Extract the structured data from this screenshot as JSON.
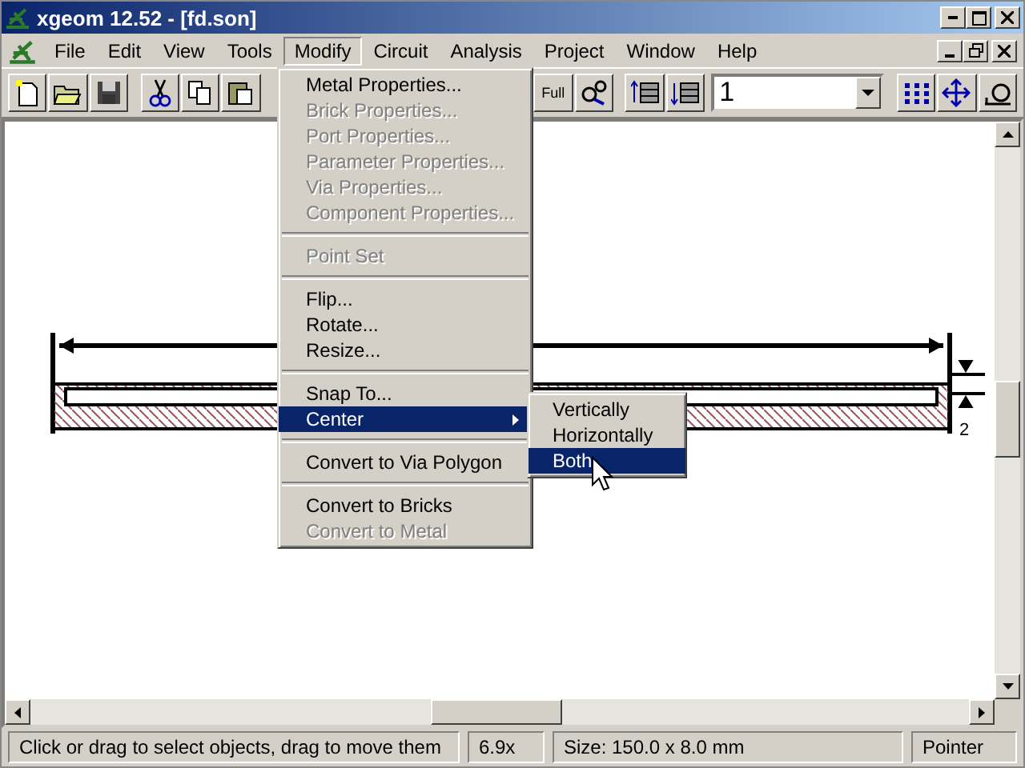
{
  "window": {
    "title": "xgeom 12.52 - [fd.son]"
  },
  "menubar": [
    {
      "label": "File",
      "selected": false
    },
    {
      "label": "Edit",
      "selected": false
    },
    {
      "label": "View",
      "selected": false
    },
    {
      "label": "Tools",
      "selected": false
    },
    {
      "label": "Modify",
      "selected": true
    },
    {
      "label": "Circuit",
      "selected": false
    },
    {
      "label": "Analysis",
      "selected": false
    },
    {
      "label": "Project",
      "selected": false
    },
    {
      "label": "Window",
      "selected": false
    },
    {
      "label": "Help",
      "selected": false
    }
  ],
  "toolbar": {
    "zoom_full_label": "Full",
    "level_select": {
      "value": "1"
    }
  },
  "menu": [
    {
      "kind": "item",
      "label": "Metal Properties...",
      "disabled": false,
      "selected": false,
      "submenu": false
    },
    {
      "kind": "item",
      "label": "Brick Properties...",
      "disabled": true,
      "selected": false,
      "submenu": false
    },
    {
      "kind": "item",
      "label": "Port Properties...",
      "disabled": true,
      "selected": false,
      "submenu": false
    },
    {
      "kind": "item",
      "label": "Parameter Properties...",
      "disabled": true,
      "selected": false,
      "submenu": false
    },
    {
      "kind": "item",
      "label": "Via Properties...",
      "disabled": true,
      "selected": false,
      "submenu": false
    },
    {
      "kind": "item",
      "label": "Component Properties...",
      "disabled": true,
      "selected": false,
      "submenu": false
    },
    {
      "kind": "separator"
    },
    {
      "kind": "item",
      "label": "Point Set",
      "disabled": true,
      "selected": false,
      "submenu": false
    },
    {
      "kind": "separator"
    },
    {
      "kind": "item",
      "label": "Flip...",
      "disabled": false,
      "selected": false,
      "submenu": false
    },
    {
      "kind": "item",
      "label": "Rotate...",
      "disabled": false,
      "selected": false,
      "submenu": false
    },
    {
      "kind": "item",
      "label": "Resize...",
      "disabled": false,
      "selected": false,
      "submenu": false
    },
    {
      "kind": "separator"
    },
    {
      "kind": "item",
      "label": "Snap To...",
      "disabled": false,
      "selected": false,
      "submenu": false
    },
    {
      "kind": "item",
      "label": "Center",
      "disabled": false,
      "selected": true,
      "submenu": true
    },
    {
      "kind": "separator"
    },
    {
      "kind": "item",
      "label": "Convert to Via Polygon",
      "disabled": false,
      "selected": false,
      "submenu": false
    },
    {
      "kind": "separator"
    },
    {
      "kind": "item",
      "label": "Convert to Bricks",
      "disabled": false,
      "selected": false,
      "submenu": false
    },
    {
      "kind": "item",
      "label": "Convert to Metal",
      "disabled": true,
      "selected": false,
      "submenu": false
    }
  ],
  "submenu": [
    {
      "label": "Vertically",
      "selected": false
    },
    {
      "label": "Horizontally",
      "selected": false
    },
    {
      "label": "Both",
      "selected": true
    }
  ],
  "drawing": {
    "dimension_label": "2"
  },
  "status_bar": {
    "message": "Click or drag to select objects, drag to move them",
    "zoom": "6.9x",
    "size": "Size: 150.0 x 8.0 mm",
    "mode": "Pointer"
  }
}
